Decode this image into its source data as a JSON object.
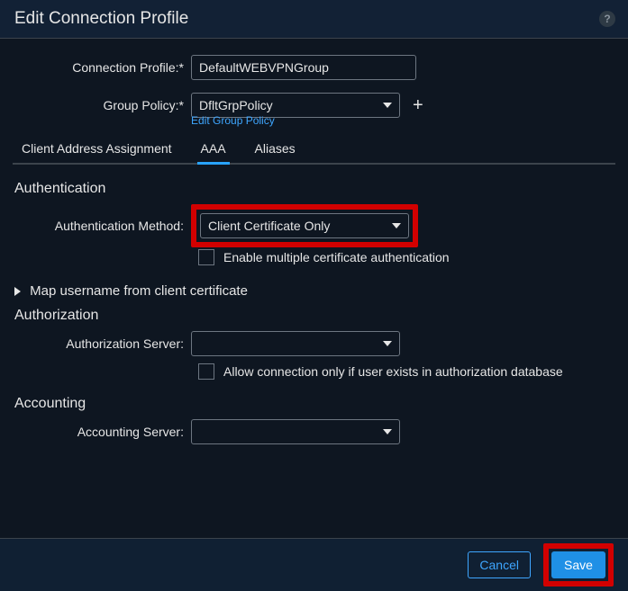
{
  "header": {
    "title": "Edit Connection Profile",
    "help_glyph": "?"
  },
  "fields": {
    "connection_profile": {
      "label": "Connection Profile:*",
      "value": "DefaultWEBVPNGroup"
    },
    "group_policy": {
      "label": "Group Policy:*",
      "selected": "DfltGrpPolicy",
      "edit_link": "Edit Group Policy",
      "plus_glyph": "+"
    }
  },
  "tabs": {
    "client_addr": "Client Address Assignment",
    "aaa": "AAA",
    "aliases": "Aliases",
    "active": "aaa"
  },
  "authentication": {
    "title": "Authentication",
    "method_label": "Authentication Method:",
    "method_value": "Client Certificate Only",
    "enable_multi_cert": "Enable multiple certificate authentication"
  },
  "map_username": {
    "label": "Map username from client certificate"
  },
  "authorization": {
    "title": "Authorization",
    "server_label": "Authorization Server:",
    "server_value": "",
    "allow_only_if_exists": "Allow connection only if user exists in authorization database"
  },
  "accounting": {
    "title": "Accounting",
    "server_label": "Accounting Server:",
    "server_value": ""
  },
  "footer": {
    "cancel": "Cancel",
    "save": "Save"
  }
}
